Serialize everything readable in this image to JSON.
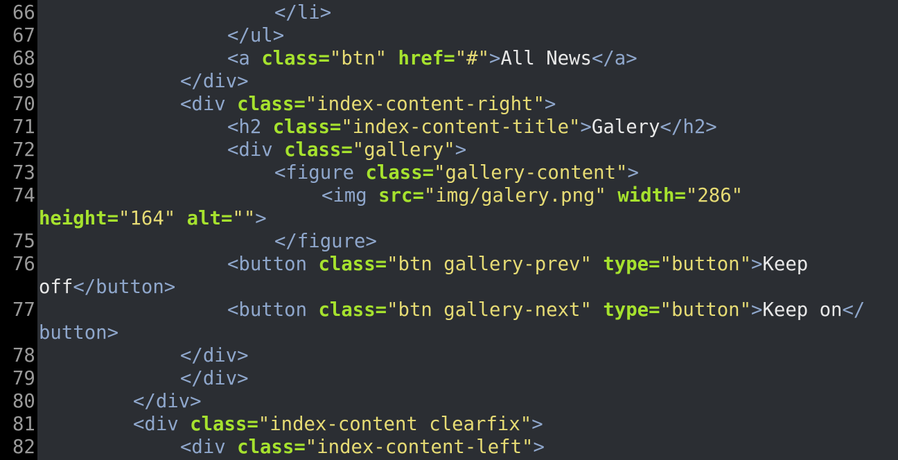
{
  "editor": {
    "lines": [
      {
        "n": "66",
        "indent": 5,
        "tokens": [
          {
            "t": "tag",
            "v": "</li>"
          }
        ]
      },
      {
        "n": "67",
        "indent": 4,
        "tokens": [
          {
            "t": "tag",
            "v": "</ul>"
          }
        ]
      },
      {
        "n": "68",
        "indent": 4,
        "tokens": [
          {
            "t": "tag",
            "v": "<a "
          },
          {
            "t": "attr",
            "v": "class="
          },
          {
            "t": "str",
            "v": "\"btn\""
          },
          {
            "t": "txt",
            "v": " "
          },
          {
            "t": "attr",
            "v": "href="
          },
          {
            "t": "str",
            "v": "\"#\""
          },
          {
            "t": "tag",
            "v": ">"
          },
          {
            "t": "txt",
            "v": "All News"
          },
          {
            "t": "tag",
            "v": "</a>"
          }
        ]
      },
      {
        "n": "69",
        "indent": 3,
        "tokens": [
          {
            "t": "tag",
            "v": "</div>"
          }
        ]
      },
      {
        "n": "70",
        "indent": 3,
        "tokens": [
          {
            "t": "tag",
            "v": "<div "
          },
          {
            "t": "attr",
            "v": "class="
          },
          {
            "t": "str",
            "v": "\"index-content-right\""
          },
          {
            "t": "tag",
            "v": ">"
          }
        ]
      },
      {
        "n": "71",
        "indent": 4,
        "tokens": [
          {
            "t": "tag",
            "v": "<h2 "
          },
          {
            "t": "attr",
            "v": "class="
          },
          {
            "t": "str",
            "v": "\"index-content-title\""
          },
          {
            "t": "tag",
            "v": ">"
          },
          {
            "t": "txt",
            "v": "Galery"
          },
          {
            "t": "tag",
            "v": "</h2>"
          }
        ]
      },
      {
        "n": "72",
        "indent": 4,
        "tokens": [
          {
            "t": "tag",
            "v": "<div "
          },
          {
            "t": "attr",
            "v": "class="
          },
          {
            "t": "str",
            "v": "\"gallery\""
          },
          {
            "t": "tag",
            "v": ">"
          }
        ]
      },
      {
        "n": "73",
        "indent": 5,
        "tokens": [
          {
            "t": "tag",
            "v": "<figure "
          },
          {
            "t": "attr",
            "v": "class="
          },
          {
            "t": "str",
            "v": "\"gallery-content\""
          },
          {
            "t": "tag",
            "v": ">"
          }
        ]
      },
      {
        "n": "74",
        "indent": 6,
        "tokens": [
          {
            "t": "tag",
            "v": "<img "
          },
          {
            "t": "attr",
            "v": "src="
          },
          {
            "t": "str",
            "v": "\"img/galery.png\""
          },
          {
            "t": "txt",
            "v": " "
          },
          {
            "t": "attr",
            "v": "width="
          },
          {
            "t": "str",
            "v": "\"286\""
          }
        ]
      },
      {
        "n": "",
        "indent": 0,
        "tokens": [
          {
            "t": "attr",
            "v": "height="
          },
          {
            "t": "str",
            "v": "\"164\""
          },
          {
            "t": "txt",
            "v": " "
          },
          {
            "t": "attr",
            "v": "alt="
          },
          {
            "t": "str",
            "v": "\"\""
          },
          {
            "t": "tag",
            "v": ">"
          }
        ]
      },
      {
        "n": "75",
        "indent": 5,
        "tokens": [
          {
            "t": "tag",
            "v": "</figure>"
          }
        ]
      },
      {
        "n": "76",
        "indent": 4,
        "tokens": [
          {
            "t": "tag",
            "v": "<button "
          },
          {
            "t": "attr",
            "v": "class="
          },
          {
            "t": "str",
            "v": "\"btn gallery-prev\""
          },
          {
            "t": "txt",
            "v": " "
          },
          {
            "t": "attr",
            "v": "type="
          },
          {
            "t": "str",
            "v": "\"button\""
          },
          {
            "t": "tag",
            "v": ">"
          },
          {
            "t": "txt",
            "v": "Keep"
          }
        ]
      },
      {
        "n": "",
        "indent": 0,
        "tokens": [
          {
            "t": "txt",
            "v": "off"
          },
          {
            "t": "tag",
            "v": "</button>"
          }
        ]
      },
      {
        "n": "77",
        "indent": 4,
        "tokens": [
          {
            "t": "tag",
            "v": "<button "
          },
          {
            "t": "attr",
            "v": "class="
          },
          {
            "t": "str",
            "v": "\"btn gallery-next\""
          },
          {
            "t": "txt",
            "v": " "
          },
          {
            "t": "attr",
            "v": "type="
          },
          {
            "t": "str",
            "v": "\"button\""
          },
          {
            "t": "tag",
            "v": ">"
          },
          {
            "t": "txt",
            "v": "Keep on"
          },
          {
            "t": "tag",
            "v": "</"
          }
        ]
      },
      {
        "n": "",
        "indent": 0,
        "tokens": [
          {
            "t": "tag",
            "v": "button>"
          }
        ]
      },
      {
        "n": "78",
        "indent": 3,
        "tokens": [
          {
            "t": "tag",
            "v": "</div>"
          }
        ]
      },
      {
        "n": "79",
        "indent": 3,
        "tokens": [
          {
            "t": "tag",
            "v": "</div>"
          }
        ]
      },
      {
        "n": "80",
        "indent": 2,
        "tokens": [
          {
            "t": "tag",
            "v": "</div>"
          }
        ]
      },
      {
        "n": "81",
        "indent": 2,
        "tokens": [
          {
            "t": "tag",
            "v": "<div "
          },
          {
            "t": "attr",
            "v": "class="
          },
          {
            "t": "str",
            "v": "\"index-content clearfix\""
          },
          {
            "t": "tag",
            "v": ">"
          }
        ]
      },
      {
        "n": "82",
        "indent": 3,
        "tokens": [
          {
            "t": "tag",
            "v": "<div "
          },
          {
            "t": "attr",
            "v": "class="
          },
          {
            "t": "str",
            "v": "\"index-content-left\""
          },
          {
            "t": "tag",
            "v": ">"
          }
        ]
      }
    ]
  }
}
